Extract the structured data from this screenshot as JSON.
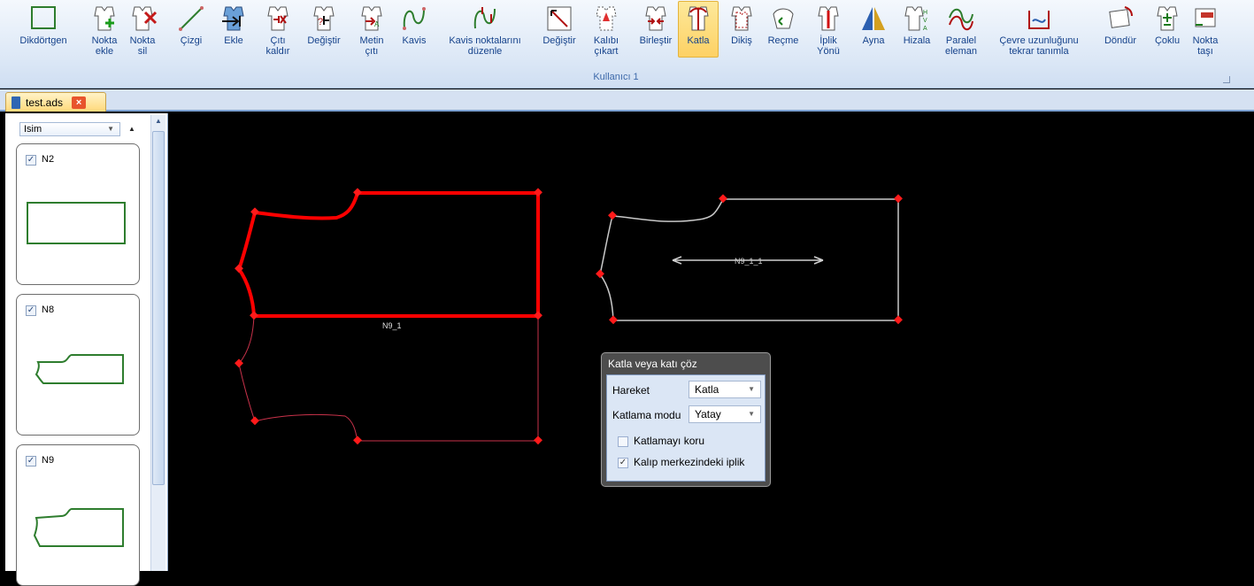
{
  "ribbon": {
    "buttons": [
      {
        "label": "Dikdörtgen",
        "icon": "rectangle-icon"
      },
      {
        "label": "Nokta\nekle",
        "icon": "add-point-icon"
      },
      {
        "label": "Nokta\nsil",
        "icon": "delete-point-icon"
      },
      {
        "label": "Çizgi",
        "icon": "line-icon"
      },
      {
        "label": "Ekle",
        "icon": "insert-icon"
      },
      {
        "label": "Çıtı\nkaldır",
        "icon": "remove-notch-icon"
      },
      {
        "label": "Değiştir",
        "icon": "change-icon"
      },
      {
        "label": "Metin\nçıtı",
        "icon": "text-notch-icon"
      },
      {
        "label": "Kavis",
        "icon": "curve-icon"
      },
      {
        "label": "Kavis noktalarını\ndüzenle",
        "icon": "edit-curve-points-icon"
      },
      {
        "label": "Değiştir",
        "icon": "modify-icon"
      },
      {
        "label": "Kalıbı\nçıkart",
        "icon": "extract-pattern-icon"
      },
      {
        "label": "Birleştir",
        "icon": "merge-icon"
      },
      {
        "label": "Katla",
        "icon": "fold-icon"
      },
      {
        "label": "Dikiş",
        "icon": "seam-icon"
      },
      {
        "label": "Reçme",
        "icon": "pleat-icon"
      },
      {
        "label": "İplik\nYönü",
        "icon": "grain-direction-icon"
      },
      {
        "label": "Ayna",
        "icon": "mirror-icon"
      },
      {
        "label": "Hizala",
        "icon": "align-icon"
      },
      {
        "label": "Paralel\neleman",
        "icon": "parallel-element-icon"
      },
      {
        "label": "Çevre uzunluğunu\ntekrar tanımla",
        "icon": "redefine-perimeter-icon"
      },
      {
        "label": "Döndür",
        "icon": "rotate-icon"
      },
      {
        "label": "Çoklu",
        "icon": "multiple-icon"
      },
      {
        "label": "Nokta\ntaşı",
        "icon": "move-point-icon"
      }
    ],
    "active_button": "Katla",
    "group_label": "Kullanıcı 1"
  },
  "document_tab": {
    "name": "test.ads",
    "close": "×"
  },
  "left_panel": {
    "sort_field": "Isim",
    "pieces": [
      {
        "name": "N2",
        "checked": true
      },
      {
        "name": "N8",
        "checked": true
      },
      {
        "name": "N9",
        "checked": true
      }
    ]
  },
  "canvas": {
    "piece_labels": [
      "N9_1",
      "N9_1_1"
    ]
  },
  "dialog": {
    "title": "Katla veya katı çöz",
    "hareket_label": "Hareket",
    "hareket_value": "Katla",
    "mode_label": "Katlama modu",
    "mode_value": "Yatay",
    "keep_fold_label": "Katlamayı koru",
    "keep_fold_checked": false,
    "center_grain_label": "Kalıp merkezindeki iplik",
    "center_grain_checked": true
  },
  "colors": {
    "selected": "#ff0000",
    "piece_outline": "#c8c8c8",
    "thumbnail": "#2e7d2e",
    "ribbon_active": "#fdd164"
  }
}
